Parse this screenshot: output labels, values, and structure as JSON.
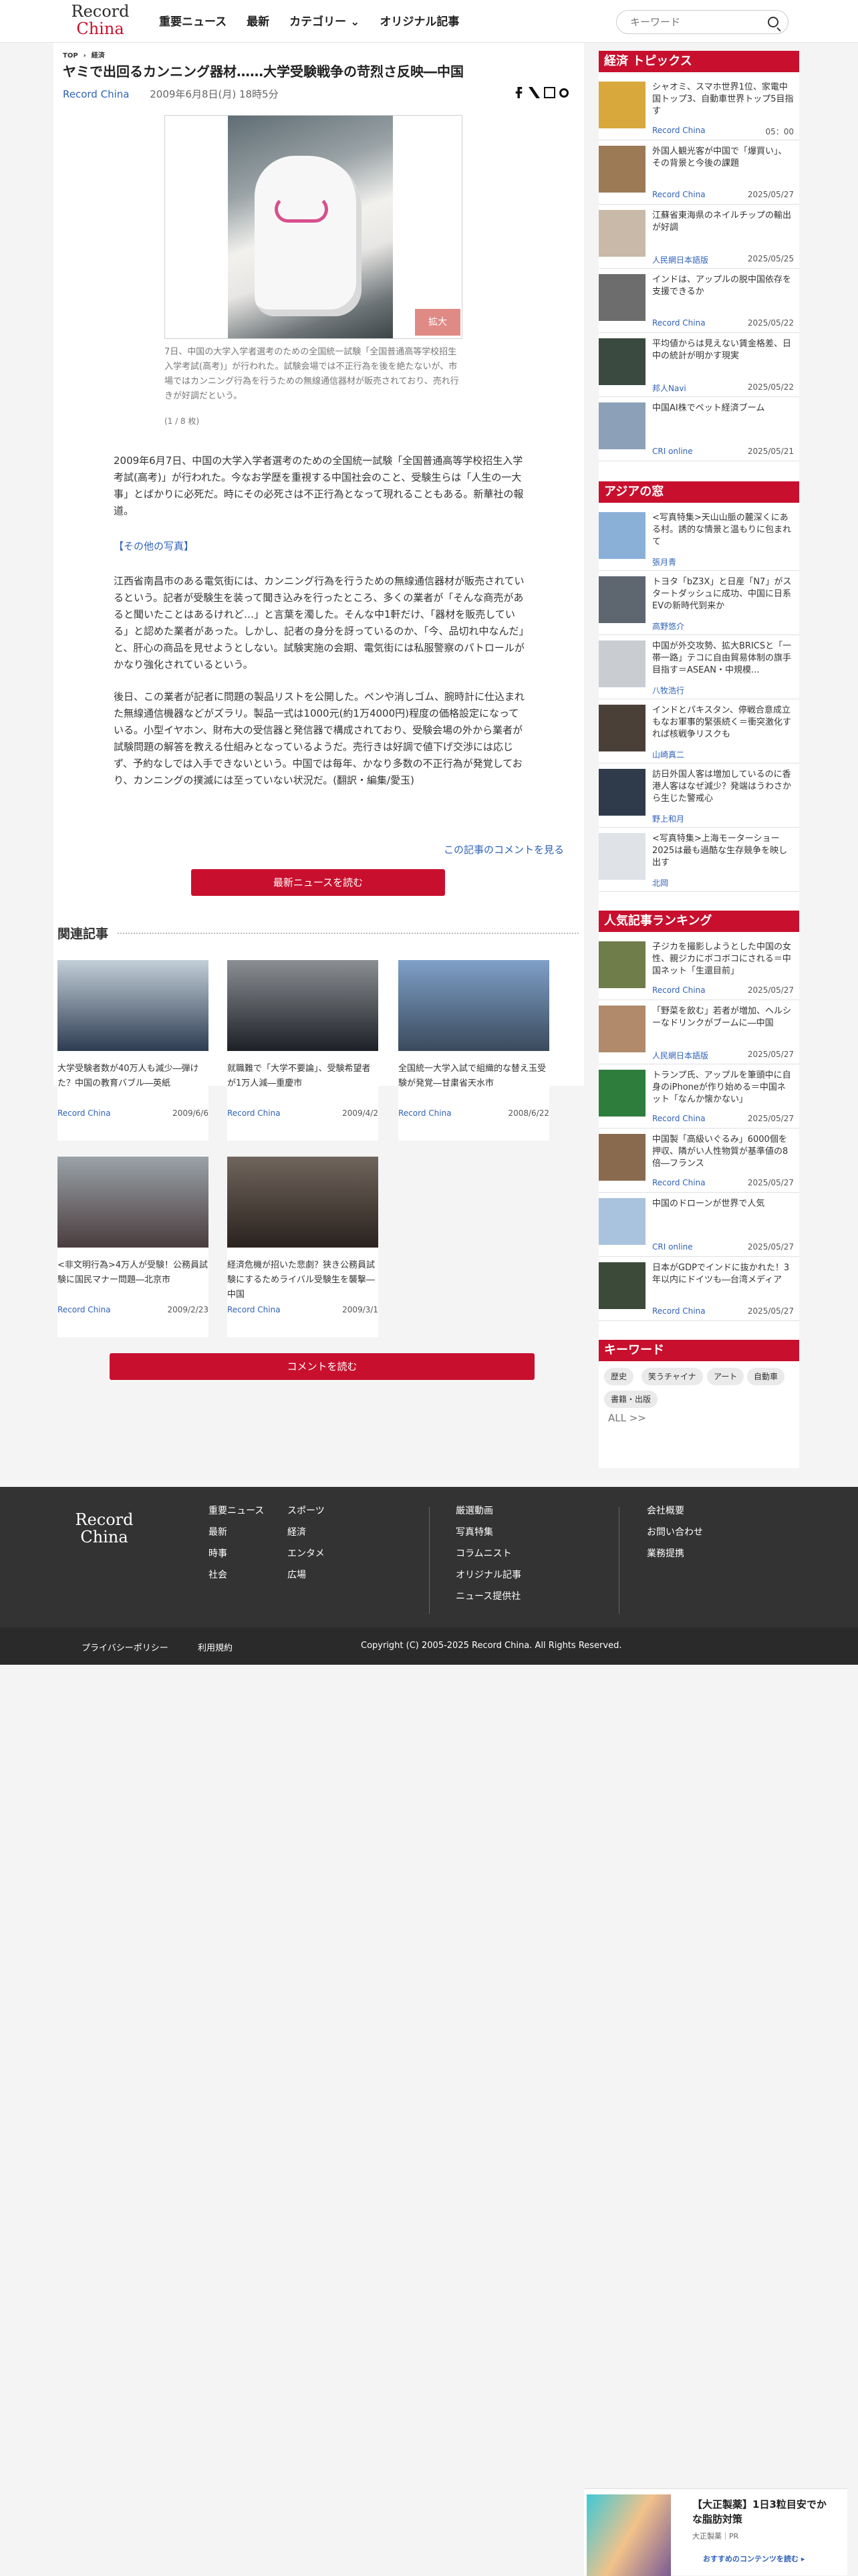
{
  "header": {
    "logo_line1": "Record",
    "logo_line2": "China",
    "nav": [
      "重要ニュース",
      "最新",
      "カテゴリー",
      "オリジナル記事"
    ],
    "search_placeholder": "キーワード"
  },
  "article": {
    "breadcrumb": [
      "TOP",
      "経済"
    ],
    "title": "ヤミで出回るカンニング器材……大学受験戦争の苛烈さ反映―中国",
    "source": "Record China",
    "date": "2009年6月8日(月) 18時5分",
    "zoom_label": "拡大",
    "caption": "7日、中国の大学入学者選考のための全国統一試験「全国普通高等学校招生入学考試(高考)」が行われた。試験会場では不正行為を後を絶たないが、市場ではカンニング行為を行うための無線通信器材が販売されており、売れ行きが好調だという。",
    "pager": "(1 / 8 枚)",
    "p1": "2009年6月7日、中国の大学入学者選考のための全国統一試験「全国普通高等学校招生入学考試(高考)」が行われた。今なお学歴を重視する中国社会のこと、受験生らは「人生の一大事」とばかりに必死だ。時にその必死さは不正行為となって現れることもある。新華社の報道。",
    "p2": "【その他の写真】",
    "p3": "江西省南昌市のある電気街には、カンニング行為を行うための無線通信器材が販売されているという。記者が受験生を装って聞き込みを行ったところ、多くの業者が「そんな商売があると聞いたことはあるけれど…」と言葉を濁した。そんな中1軒だけ、「器材を販売している」と認めた業者があった。しかし、記者の身分を訝っているのか、「今、品切れ中なんだ」と、肝心の商品を見せようとしない。試験実施の会期、電気街には私服警察のパトロールがかなり強化されているという。",
    "p4": "後日、この業者が記者に問題の製品リストを公開した。ペンや消しゴム、腕時計に仕込まれた無線通信機器などがズラリ。製品一式は1000元(約1万4000円)程度の価格設定になっている。小型イヤホン、財布大の受信器と発信器で構成されており、受験会場の外から業者が試験問題の解答を教える仕組みとなっているようだ。売行きは好調で値下げ交渉には応じず、予約なしでは入手できないという。中国では毎年、かなり多数の不正行為が発覚しており、カンニングの撲滅には至っていない状況だ。(翻訳・編集/愛玉)",
    "more_comments": "この記事のコメントを見る",
    "latest_button": "最新ニュースを読む",
    "comment_button": "コメントを読む"
  },
  "related": {
    "heading": "関連記事",
    "items": [
      {
        "title": "大学受験者数が40万人も減少―弾けた？中国の教育バブル―英紙",
        "source": "Record China",
        "date": "2009/6/6"
      },
      {
        "title": "就職難で「大学不要論」、受験希望者が1万人減―重慶市",
        "source": "Record China",
        "date": "2009/4/2"
      },
      {
        "title": "全国統一大学入試で組織的な替え玉受験が発覚―甘粛省天水市",
        "source": "Record China",
        "date": "2008/6/22"
      },
      {
        "title": "<非文明行為>4万人が受験！公務員試験に国民マナー問題―北京市",
        "source": "Record China",
        "date": "2009/2/23"
      },
      {
        "title": "経済危機が招いた悲劇？狭き公務員試験にするためライバル受験生を襲撃―中国",
        "source": "Record China",
        "date": "2009/3/1"
      }
    ]
  },
  "sidebar": {
    "topics_heading": "経済 トピックス",
    "topics": [
      {
        "title": "シャオミ、スマホ世界1位、家電中国トップ3、自動車世界トップ5目指す",
        "source": "Record China",
        "date": "05：00"
      },
      {
        "title": "外国人観光客が中国で「爆買い」、その背景と今後の課題",
        "source": "Record China",
        "date": "2025/05/27"
      },
      {
        "title": "江蘇省東海県のネイルチップの輸出が好調",
        "source": "人民網日本語版",
        "date": "2025/05/25"
      },
      {
        "title": "インドは、アップルの脱中国依存を支援できるか",
        "source": "Record China",
        "date": "2025/05/22"
      },
      {
        "title": "平均値からは見えない賃金格差、日中の統計が明かす現実",
        "source": "邦人Navi",
        "date": "2025/05/22"
      },
      {
        "title": "中国AI株でペット経済ブーム",
        "source": "CRI online",
        "date": "2025/05/21"
      }
    ],
    "asia_heading": "アジアの窓",
    "asia": [
      {
        "title": "<写真特集>天山山脈の麓深くにある村。誘的な情景と温もりに包まれて",
        "source": "張月青"
      },
      {
        "title": "トヨタ「bZ3X」と日産「N7」がスタートダッシュに成功、中国に日系EVの新時代到来か",
        "source": "高野悠介"
      },
      {
        "title": "中国が外交攻勢、拡大BRICSと「一帯一路」テコに自由貿易体制の旗手目指す＝ASEAN・中規模...",
        "source": "八牧浩行"
      },
      {
        "title": "インドとパキスタン、停戦合意成立もなお軍事的緊張続く＝衝突激化すれば核戦争リスクも",
        "source": "山崎真二"
      },
      {
        "title": "訪日外国人客は増加しているのに香港人客はなぜ減少？発端はうわさから生じた警戒心",
        "source": "野上和月"
      },
      {
        "title": "<写真特集>上海モーターショー2025は最も過酷な生存競争を映し出す",
        "source": "北岡"
      }
    ],
    "ranking_heading": "人気記事ランキング",
    "ranking": [
      {
        "title": "子ジカを撮影しようとした中国の女性、親ジカにボコボコにされる＝中国ネット「生還目前」",
        "source": "Record China",
        "date": "2025/05/27"
      },
      {
        "title": "「野菜を飲む」若者が増加、ヘルシーなドリンクがブームに―中国",
        "source": "人民網日本語版",
        "date": "2025/05/27"
      },
      {
        "title": "トランプ氏、アップルを筆頭中に自身のiPhoneが作り始める＝中国ネット「なんか懐かない」",
        "source": "Record China",
        "date": "2025/05/27"
      },
      {
        "title": "中国製「高級いぐるみ」6000個を押収、隣がい人性物質が基準値の8倍―フランス",
        "source": "Record China",
        "date": "2025/05/27"
      },
      {
        "title": "中国のドローンが世界で人気",
        "source": "CRI online",
        "date": "2025/05/27"
      },
      {
        "title": "日本がGDPでインドに抜かれた！3年以内にドイツも―台湾メディア",
        "source": "Record China",
        "date": "2025/05/27"
      }
    ],
    "keyword_heading": "キーワード",
    "keywords": [
      "歴史",
      "笑うチャイナ",
      "アート",
      "自動車",
      "書籍・出版"
    ],
    "keywords_all": "ALL >>"
  },
  "footer": {
    "logo_line1": "Record",
    "logo_line2": "China",
    "col1": [
      "重要ニュース",
      "最新",
      "時事",
      "社会"
    ],
    "col2": [
      "スポーツ",
      "経済",
      "エンタメ",
      "広場"
    ],
    "col3": [
      "厳選動画",
      "写真特集",
      "コラムニスト",
      "オリジナル記事",
      "ニュース提供社"
    ],
    "col4": [
      "会社概要",
      "お問い合わせ",
      "業務提携"
    ],
    "privacy": "プライバシーポリシー",
    "terms": "利用規約",
    "copyright": "Copyright (C) 2005-2025 Record China. All Rights Reserved."
  },
  "ad": {
    "title": "【大正製薬】1日3粒目安でかな脂肪対策",
    "sponsor": "大正製薬｜PR",
    "cta": "おすすめのコンテンツを読む ▸"
  }
}
